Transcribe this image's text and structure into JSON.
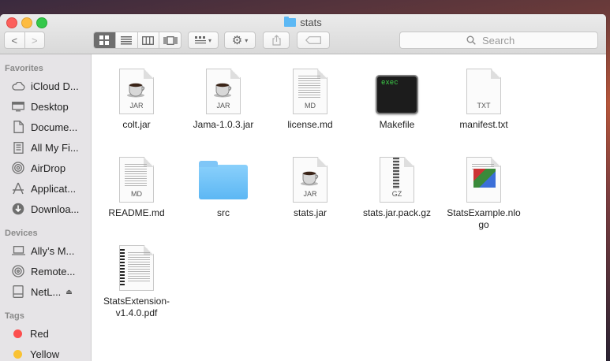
{
  "window": {
    "title": "stats"
  },
  "toolbar": {
    "back": "<",
    "forward": ">",
    "view_icons": "grid-view-icon",
    "view_list": "list-view-icon",
    "view_columns": "column-view-icon",
    "view_gallery": "cover-flow-icon",
    "arrange": "arrange-icon",
    "action": "gear-icon",
    "share": "share-icon",
    "tags": "tag-icon"
  },
  "search": {
    "placeholder": "Search"
  },
  "sidebar": {
    "favorites_header": "Favorites",
    "favorites": [
      {
        "label": "iCloud D...",
        "icon": "cloud-icon"
      },
      {
        "label": "Desktop",
        "icon": "desktop-icon"
      },
      {
        "label": "Docume...",
        "icon": "documents-icon"
      },
      {
        "label": "All My Fi...",
        "icon": "all-files-icon"
      },
      {
        "label": "AirDrop",
        "icon": "airdrop-icon"
      },
      {
        "label": "Applicat...",
        "icon": "applications-icon"
      },
      {
        "label": "Downloa...",
        "icon": "downloads-icon"
      }
    ],
    "devices_header": "Devices",
    "devices": [
      {
        "label": "Ally’s M...",
        "icon": "laptop-icon"
      },
      {
        "label": "Remote...",
        "icon": "disc-icon"
      },
      {
        "label": "NetL...",
        "icon": "drive-icon"
      }
    ],
    "tags_header": "Tags",
    "tags": [
      {
        "label": "Red",
        "color": "#fc4e4e"
      },
      {
        "label": "Yellow",
        "color": "#f9c234"
      }
    ]
  },
  "files": [
    {
      "name": "colt.jar",
      "type": "JAR"
    },
    {
      "name": "Jama-1.0.3.jar",
      "type": "JAR"
    },
    {
      "name": "license.md",
      "type": "MD"
    },
    {
      "name": "Makefile",
      "type": "exec"
    },
    {
      "name": "manifest.txt",
      "type": "TXT"
    },
    {
      "name": "README.md",
      "type": "MD"
    },
    {
      "name": "src",
      "type": "folder"
    },
    {
      "name": "stats.jar",
      "type": "JAR"
    },
    {
      "name": "stats.jar.pack.gz",
      "type": "GZ"
    },
    {
      "name": "StatsExample.nlogo",
      "type": "nlogo"
    },
    {
      "name": "StatsExtension-v1.4.0.pdf",
      "type": "pdf"
    }
  ]
}
